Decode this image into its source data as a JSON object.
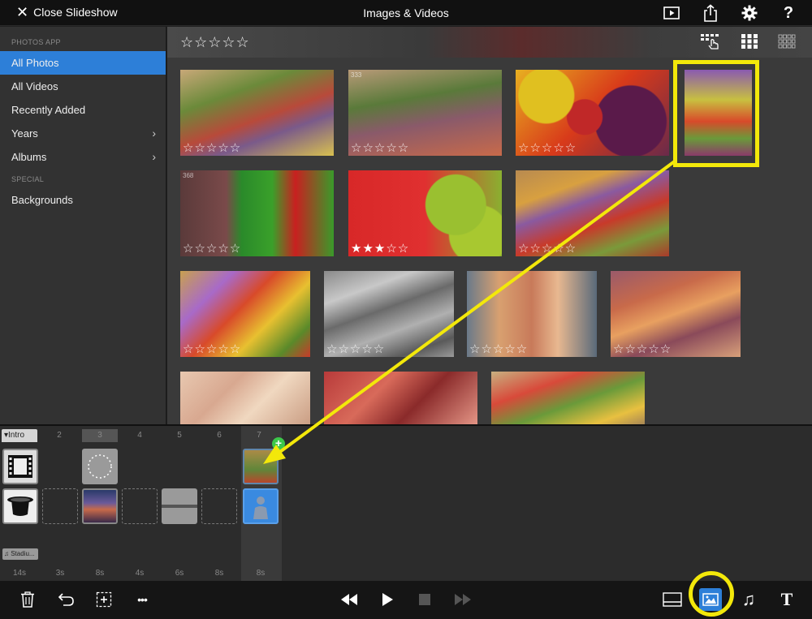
{
  "topbar": {
    "close_label": "Close Slideshow",
    "title": "Images & Videos",
    "icons": [
      "play-preview-icon",
      "share-icon",
      "settings-gear-icon",
      "help-icon"
    ],
    "help_glyph": "?"
  },
  "sidebar": {
    "section_photos": "PHOTOS APP",
    "items": [
      {
        "label": "All Photos",
        "active": true
      },
      {
        "label": "All Videos"
      },
      {
        "label": "Recently Added"
      },
      {
        "label": "Years",
        "chevron": true
      },
      {
        "label": "Albums",
        "chevron": true
      }
    ],
    "section_special": "SPECIAL",
    "special_items": [
      {
        "label": "Backgrounds"
      }
    ],
    "chevron_glyph": "›"
  },
  "header": {
    "rating_filter": "☆☆☆☆☆",
    "view_icons": [
      "multi-select-icon",
      "grid-medium-icon",
      "grid-small-icon"
    ]
  },
  "photos": [
    {
      "num": "",
      "rating": "☆☆☆☆☆"
    },
    {
      "num": "333",
      "rating": "☆☆☆☆☆"
    },
    {
      "num": "",
      "rating": "☆☆☆☆☆"
    },
    {
      "num": "",
      "rating": ""
    },
    {
      "num": "368",
      "rating": "☆☆☆☆☆"
    },
    {
      "num": "",
      "rating": "★★★☆☆"
    },
    {
      "num": "",
      "rating": "☆☆☆☆☆"
    },
    {
      "num": "",
      "rating": "☆☆☆☆☆"
    },
    {
      "num": "",
      "rating": "☆☆☆☆☆"
    },
    {
      "num": "",
      "rating": "☆☆☆☆☆"
    },
    {
      "num": "",
      "rating": "☆☆☆☆☆"
    },
    {
      "num": "",
      "rating": ""
    },
    {
      "num": "",
      "rating": ""
    },
    {
      "num": "",
      "rating": ""
    }
  ],
  "timeline": {
    "intro_label": "▾Intro",
    "slide_numbers": [
      "2",
      "3",
      "4",
      "5",
      "6",
      "7"
    ],
    "durations": [
      "14s",
      "3s",
      "8s",
      "4s",
      "6s",
      "8s",
      "8s"
    ],
    "music_label": "♫ Stadiu...",
    "plus": "+"
  },
  "toolbar": {
    "left_icons": [
      "trash-icon",
      "undo-icon",
      "add-slide-icon",
      "more-icon"
    ],
    "more_glyph": "•••",
    "transport_icons": [
      "rewind-icon",
      "play-icon",
      "stop-icon",
      "fast-forward-icon"
    ],
    "right_icons": [
      "layout-icon",
      "images-icon",
      "music-icon",
      "text-icon"
    ],
    "text_glyph": "T",
    "music_glyph": "♫"
  },
  "colors": {
    "accent": "#2d7fd8",
    "highlight": "#f3e80a",
    "add_badge": "#3cc84a"
  }
}
